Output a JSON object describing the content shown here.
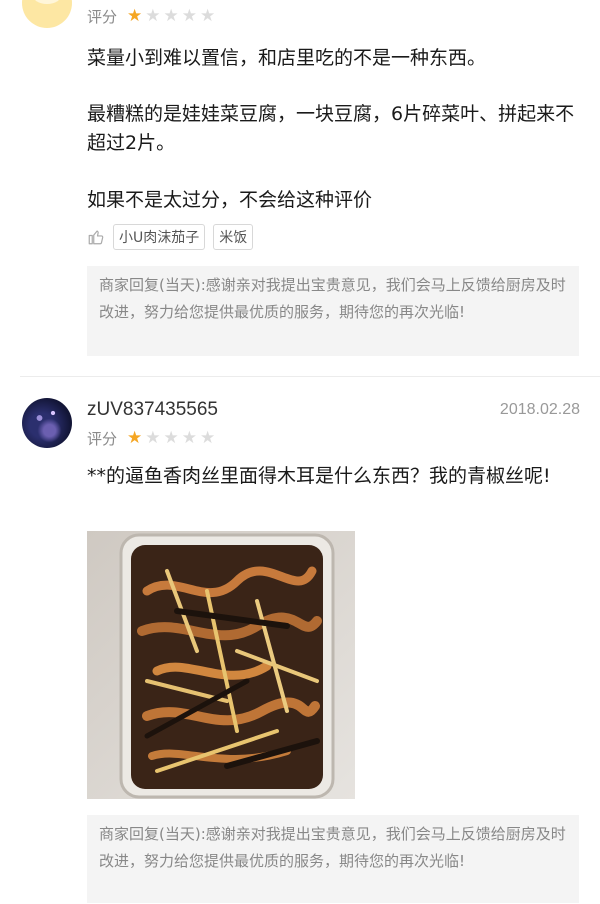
{
  "reviews": [
    {
      "rating_label": "评分",
      "stars": 1,
      "paragraphs": [
        "菜量小到难以置信，和店里吃的不是一种东西。",
        "最糟糕的是娃娃菜豆腐，一块豆腐，6片碎菜叶、拼起来不超过2片。",
        "如果不是太过分，不会给这种评价"
      ],
      "tags": [
        "小U肉沫茄子",
        "米饭"
      ],
      "reply": "商家回复(当天):感谢亲对我提出宝贵意见，我们会马上反馈给厨房及时改进，努力给您提供最优质的服务，期待您的再次光临!"
    },
    {
      "username": "zUV837435565",
      "date": "2018.02.28",
      "rating_label": "评分",
      "stars": 1,
      "paragraphs": [
        "**的逼鱼香肉丝里面得木耳是什么东西？我的青椒丝呢!"
      ],
      "reply": "商家回复(当天):感谢亲对我提出宝贵意见，我们会马上反馈给厨房及时改进，努力给您提供最优质的服务，期待您的再次光临!"
    }
  ],
  "icons": {
    "star": "star-icon",
    "like": "thumbs-up-icon"
  },
  "colors": {
    "star_on": "#f5a623",
    "star_off": "#dcdcdc",
    "reply_bg": "#f4f4f4"
  }
}
